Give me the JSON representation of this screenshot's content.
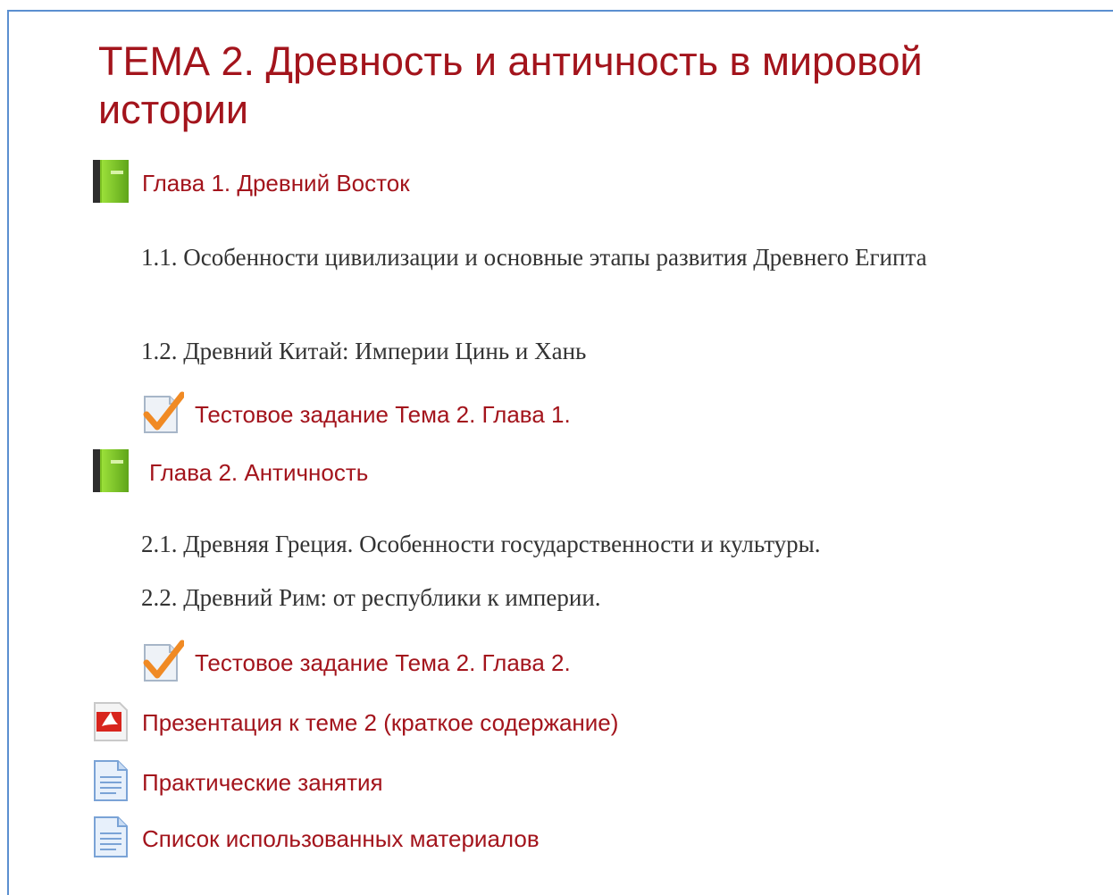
{
  "section": {
    "title": "ТЕМА 2. Древность и античность в мировой истории"
  },
  "items": {
    "chapter1": {
      "label": "Глава 1. Древний Восток",
      "icon": "book-icon"
    },
    "ch1_para1": "1.1. Особенности цивилизации и основные этапы развития Древнего Египта",
    "ch1_para2": "1.2. Древний Китай: Империи Цинь и Хань",
    "quiz1": {
      "label": "Тестовое задание Тема 2. Глава 1.",
      "icon": "quiz-checkmark-icon"
    },
    "chapter2": {
      "label": "Глава 2. Античность",
      "icon": "book-icon"
    },
    "ch2_para1": "2.1. Древняя Греция. Особенности государственности и культуры.",
    "ch2_para2": "2.2. Древний Рим: от республики к империи.",
    "quiz2": {
      "label": "Тестовое задание Тема 2. Глава 2.",
      "icon": "quiz-checkmark-icon"
    },
    "presentation": {
      "label": "Презентация к теме 2 (краткое содержание)",
      "icon": "pdf-icon"
    },
    "practical": {
      "label": "Практические занятия",
      "icon": "document-icon"
    },
    "references": {
      "label": "Список использованных материалов",
      "icon": "document-icon"
    }
  },
  "colors": {
    "link": "#a3141c",
    "text": "#333333",
    "frame_border": "#5b8fd0"
  }
}
